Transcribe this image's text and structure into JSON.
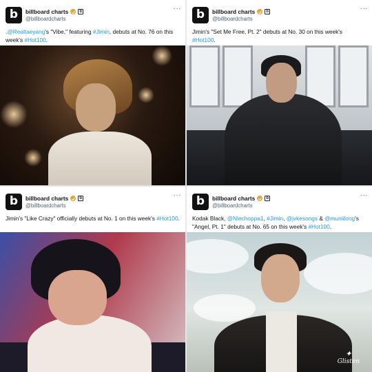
{
  "account": {
    "name": "billboard charts",
    "handle": "@billboardcharts",
    "avatar_letter": "b",
    "verified_badge": "gold-check",
    "affiliate_badge": "b"
  },
  "tweets": [
    {
      "parts": [
        {
          "text": ".",
          "link": false
        },
        {
          "text": "@Realtaeyang",
          "link": true
        },
        {
          "text": "'s \"Vibe,\" featuring ",
          "link": false
        },
        {
          "text": "#Jimin",
          "link": true
        },
        {
          "text": ", debuts at No. 76 on this week's ",
          "link": false
        },
        {
          "text": "#Hot100",
          "link": true
        },
        {
          "text": ".",
          "link": false
        }
      ]
    },
    {
      "parts": [
        {
          "text": "Jimin's \"Set Me Free, Pt. 2\" debuts at No. 30 on this week's ",
          "link": false
        },
        {
          "text": "#Hot100",
          "link": true
        },
        {
          "text": ".",
          "link": false
        }
      ]
    },
    {
      "parts": [
        {
          "text": "Jimin's \"Like Crazy\" officially debuts at No. 1 on this week's ",
          "link": false
        },
        {
          "text": "#Hot100",
          "link": true
        },
        {
          "text": ".",
          "link": false
        }
      ]
    },
    {
      "parts": [
        {
          "text": "Kodak Black, ",
          "link": false
        },
        {
          "text": "@Nlechoppa1",
          "link": true
        },
        {
          "text": ", ",
          "link": false
        },
        {
          "text": "#Jimin",
          "link": true
        },
        {
          "text": ", ",
          "link": false
        },
        {
          "text": "@jvkesongs",
          "link": true
        },
        {
          "text": " & ",
          "link": false
        },
        {
          "text": "@muniilong",
          "link": true
        },
        {
          "text": "'s \"Angel, Pt. 1\" debuts at No. 65 on this week's ",
          "link": false
        },
        {
          "text": "#Hot100",
          "link": true
        },
        {
          "text": ".",
          "link": false
        }
      ]
    }
  ],
  "more_label": "···",
  "watermark": {
    "mark": "✦",
    "text": "Glisten"
  },
  "colors": {
    "link": "#1d9bf0",
    "badge_gold": "#e8a33a",
    "muted": "#536471"
  }
}
